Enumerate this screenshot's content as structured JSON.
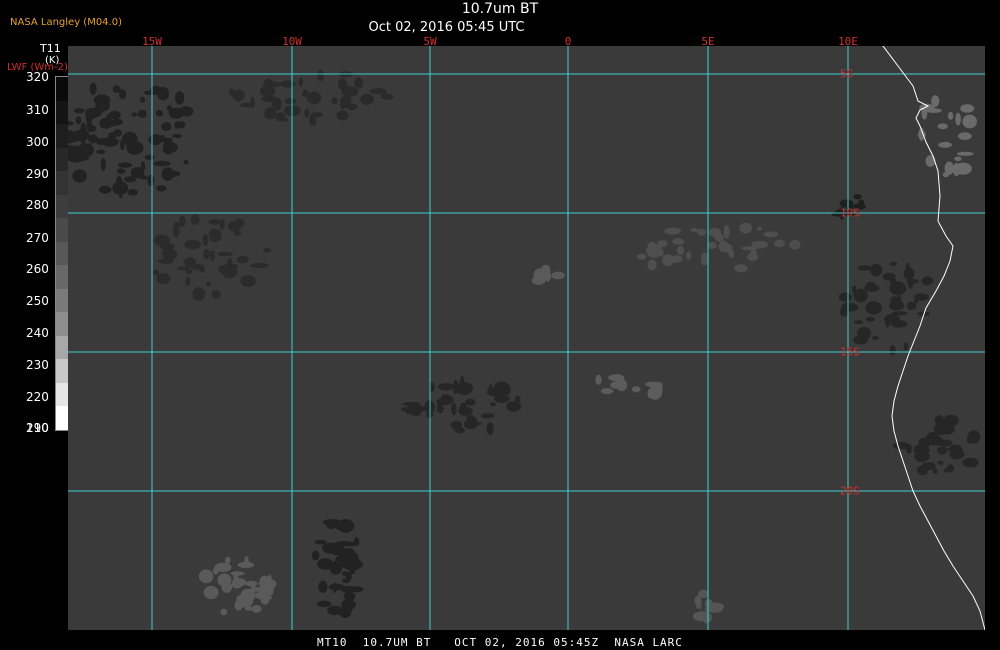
{
  "header": {
    "producer": "NASA Langley (M04.0)",
    "title": "10.7um BT",
    "subtitle": "Oct 02, 2016 05:45 UTC"
  },
  "colorbar": {
    "variable": "T11",
    "unit": "(K)",
    "secondary_label": "LWF (Wm-2)",
    "ticks": [
      "320",
      "310",
      "300",
      "290",
      "280",
      "270",
      "260",
      "250",
      "240",
      "230",
      "220",
      "210",
      "190"
    ],
    "segment_colors": [
      "#0a0a0a",
      "#141414",
      "#1e1e1e",
      "#282828",
      "#333333",
      "#3d3d3d",
      "#4a4a4a",
      "#585858",
      "#686868",
      "#7a7a7a",
      "#8e8e8e",
      "#a8a8a8",
      "#c8c8c8",
      "#e6e6e6",
      "#ffffff"
    ]
  },
  "map": {
    "longitude_labels": [
      "15W",
      "10W",
      "5W",
      "0",
      "5E",
      "10E"
    ],
    "latitude_labels": [
      "5S",
      "10S",
      "15S",
      "20S"
    ],
    "grid_color": "#40d0d0",
    "label_color": "#d03030",
    "coastline_color": "#ffffff",
    "background_color": "#3a3a3a"
  },
  "footer": {
    "text": "MT10  10.7UM BT   OCT 02, 2016 05:45Z  NASA LARC"
  }
}
